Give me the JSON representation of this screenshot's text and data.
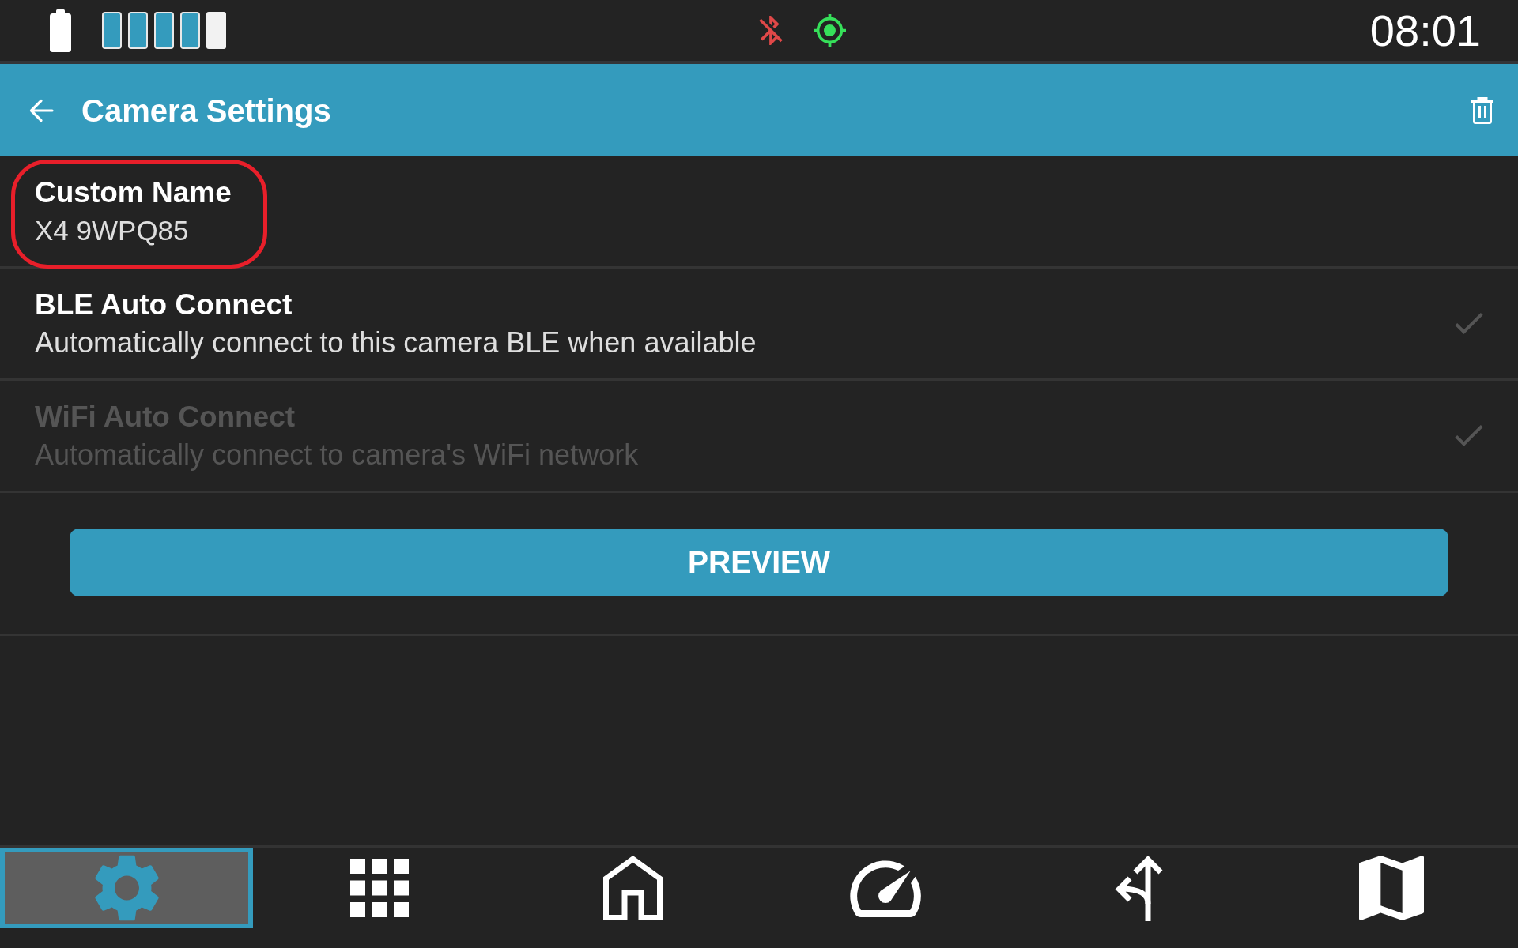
{
  "status_bar": {
    "time": "08:01"
  },
  "header": {
    "title": "Camera Settings"
  },
  "settings": [
    {
      "kind": "value",
      "title": "Custom Name",
      "value": "X4 9WPQ85",
      "disabled": false,
      "highlighted": true
    },
    {
      "kind": "toggle",
      "title": "BLE Auto Connect",
      "subtitle": "Automatically connect to this camera BLE when available",
      "checked": true,
      "disabled": false,
      "highlighted": false
    },
    {
      "kind": "toggle",
      "title": "WiFi Auto Connect",
      "subtitle": "Automatically connect to camera's WiFi network",
      "checked": true,
      "disabled": true,
      "highlighted": false
    }
  ],
  "preview_button": {
    "label": "PREVIEW"
  },
  "nav": [
    {
      "selected": true
    },
    {
      "selected": false
    },
    {
      "selected": false
    },
    {
      "selected": false
    },
    {
      "selected": false
    },
    {
      "selected": false
    }
  ]
}
